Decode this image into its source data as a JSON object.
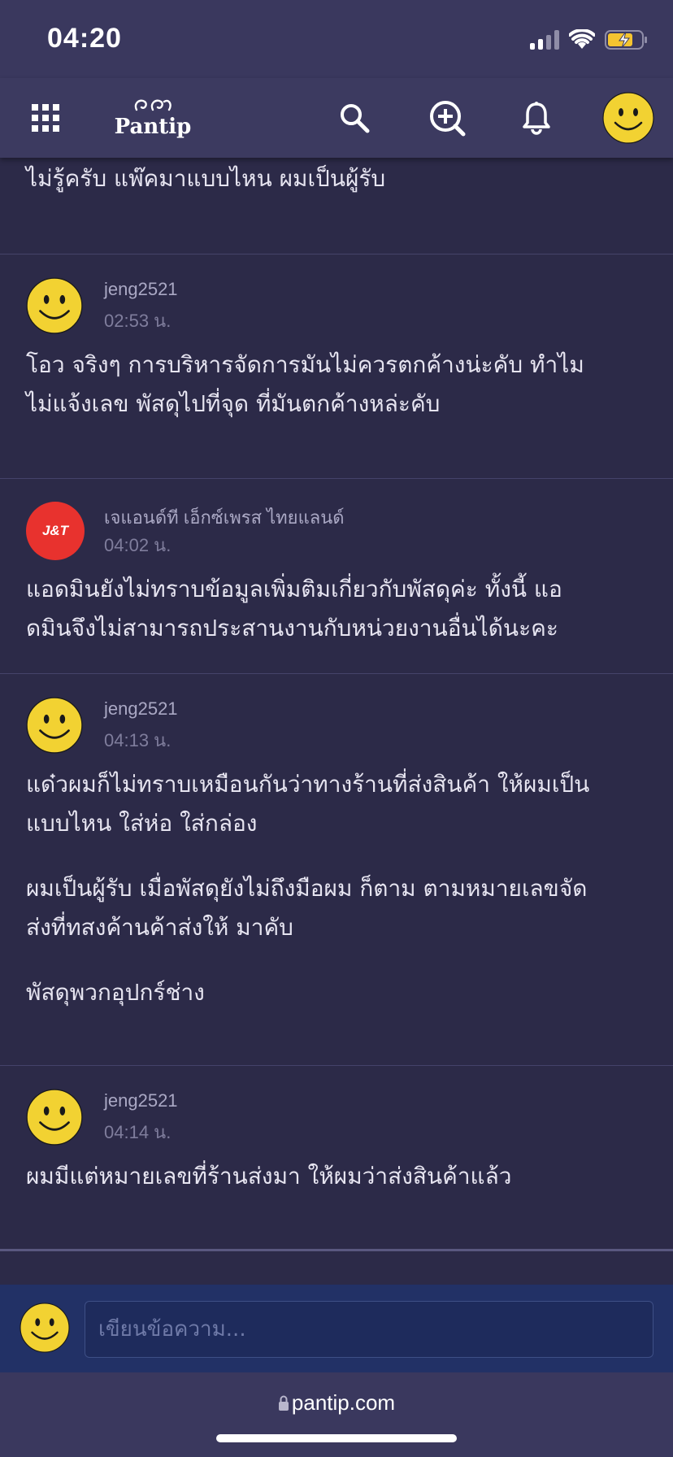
{
  "status_bar": {
    "time": "04:20"
  },
  "nav": {
    "logo_text": "Pantip",
    "icons": [
      "grid-menu-icon",
      "search-icon",
      "new-topic-icon",
      "bell-icon",
      "profile-avatar"
    ]
  },
  "feed": {
    "partial_post_text": "ไม่รู้ครับ แพ๊คมาแบบไหน   ผมเป็นผู้รับ",
    "comments": [
      {
        "author": "jeng2521",
        "time": "02:53 น.",
        "paragraphs": [
          "โอว จริงๆ การบริหารจัดการมันไม่ควรตกค้างน่ะคับ  ทำไม",
          "ไม่แจ้งเลข พัสดุไปที่จุด ที่มันตกค้างหล่ะคับ"
        ]
      },
      {
        "author": "เจแอนด์ที เอ็กซ์เพรส ไทยแลนด์",
        "time": "04:02 น.",
        "avatar_text": "J&T",
        "paragraphs": [
          "แอดมินยังไม่ทราบข้อมูลเพิ่มติมเกี่ยวกับพัสดุค่ะ ทั้งนี้ แอ",
          "ดมินจึงไม่สามารถประสานงานกับหน่วยงานอื่นได้นะคะ"
        ]
      },
      {
        "author": "jeng2521",
        "time": "04:13 น.",
        "paragraphs": [
          "แด๋วผมก็ไม่ทราบเหมือนกันว่าทางร้านที่ส่งสินค้า ให้ผมเป็น",
          "แบบไหน  ใส่ห่อ  ใส่กล่อง",
          "ผมเป็นผู้รับ  เมื่อพัสดุยังไม่ถึงมือผม  ก็ตาม  ตามหมายเลขจัด",
          "ส่งที่ทสงค้านค้าส่งให้  มาคับ",
          "พัสดุพวกอุปกร์ช่าง"
        ]
      },
      {
        "author": "jeng2521",
        "time": "04:14 น.",
        "paragraphs": [
          "ผมมีแต่หมายเลขที่ร้านส่งมา ให้ผมว่าส่งสินค้าแล้ว"
        ]
      }
    ]
  },
  "reply": {
    "placeholder": "เขียนข้อความ..."
  },
  "browser": {
    "url": "pantip.com"
  },
  "colors": {
    "background": "#2c2a48",
    "nav": "#3c3a60",
    "smiley": "#f2d232",
    "jt_red": "#e8322e",
    "reply_bar": "#223166"
  }
}
